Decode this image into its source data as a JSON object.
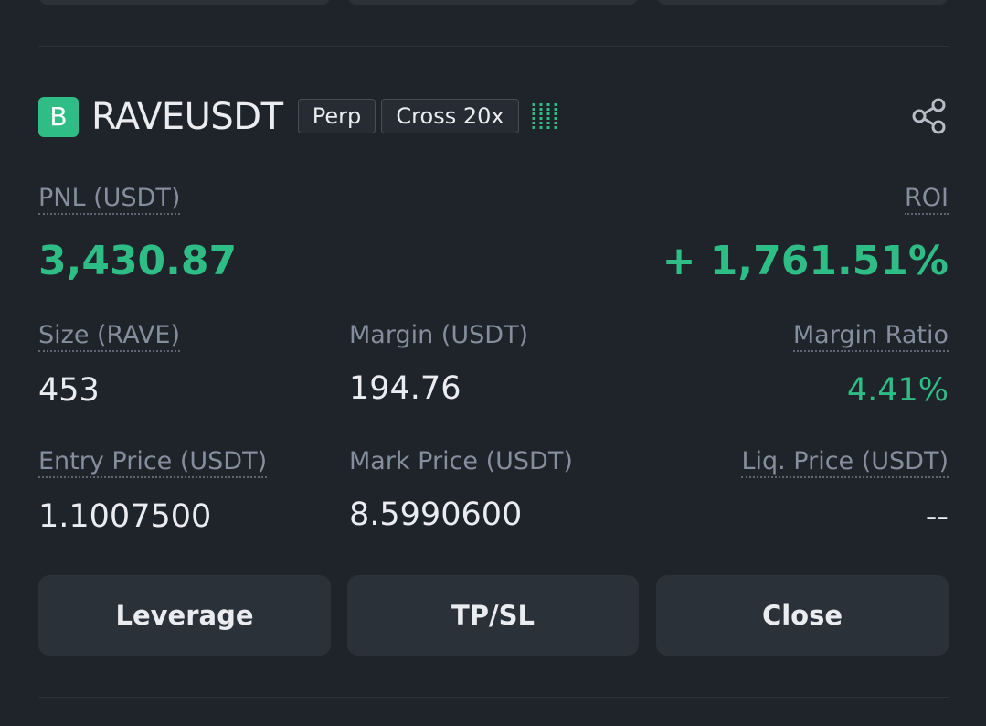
{
  "position": {
    "badge_letter": "B",
    "symbol": "RAVEUSDT",
    "contract_type": "Perp",
    "margin_mode": "Cross 20x",
    "pnl_label": "PNL (USDT)",
    "pnl_value": "3,430.87",
    "roi_label": "ROI",
    "roi_value": "+ 1,761.51%",
    "size_label": "Size (RAVE)",
    "size_value": "453",
    "margin_label": "Margin (USDT)",
    "margin_value": "194.76",
    "margin_ratio_label": "Margin Ratio",
    "margin_ratio_value": "4.41%",
    "entry_price_label": "Entry Price (USDT)",
    "entry_price_value": "1.1007500",
    "mark_price_label": "Mark Price (USDT)",
    "mark_price_value": "8.5990600",
    "liq_price_label": "Liq. Price (USDT)",
    "liq_price_value": "--"
  },
  "actions": {
    "leverage": "Leverage",
    "tpsl": "TP/SL",
    "close": "Close"
  },
  "icons": {
    "signal": "signal-strength-icon",
    "share": "share-icon"
  },
  "colors": {
    "background": "#1f232a",
    "positive": "#2ebd85",
    "button_bg": "#2b3139",
    "label": "#848e9c",
    "text": "#eaecef"
  }
}
